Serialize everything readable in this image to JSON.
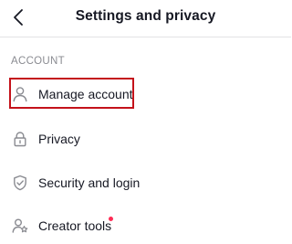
{
  "header": {
    "title": "Settings and privacy",
    "back_icon": "chevron-left-icon"
  },
  "sections": [
    {
      "title": "ACCOUNT",
      "items": [
        {
          "label": "Manage account",
          "icon": "person-icon",
          "highlighted": true
        },
        {
          "label": "Privacy",
          "icon": "lock-icon"
        },
        {
          "label": "Security and login",
          "icon": "shield-icon"
        },
        {
          "label": "Creator tools",
          "icon": "person-star-icon",
          "notification_dot": true
        }
      ]
    }
  ],
  "colors": {
    "text": "#161823",
    "section_title": "#8a8b91",
    "icon": "#8a8b91",
    "highlight_border": "#c4121a",
    "notification_dot": "#fe2c55"
  }
}
